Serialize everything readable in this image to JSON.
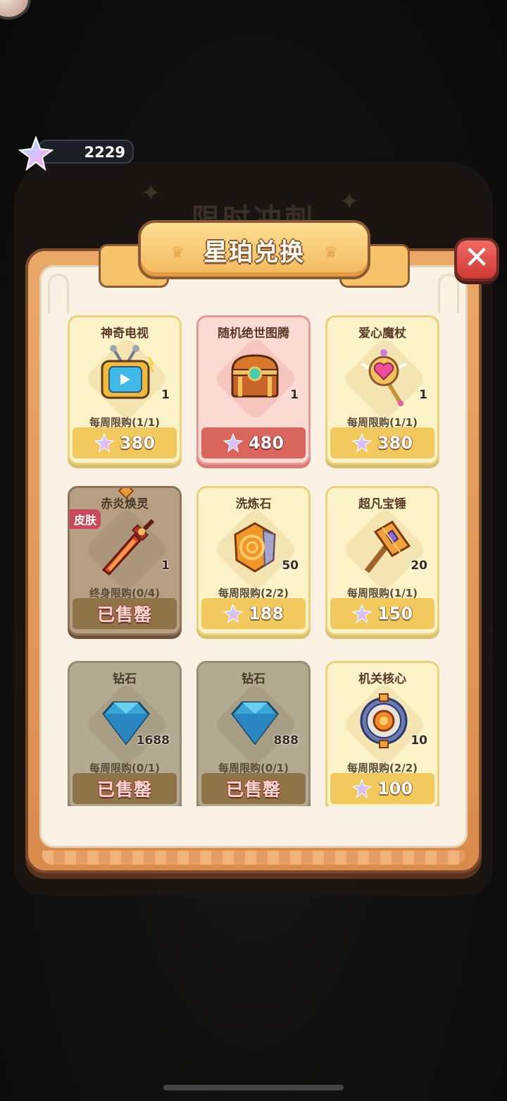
{
  "header": {
    "currency_value": "2229"
  },
  "dialog": {
    "background_title": "限时冲刺",
    "title": "星珀兑换",
    "close_label": "✕"
  },
  "items": [
    {
      "name": "神奇电视",
      "qty": "1",
      "limit": "每周限购(1/1)",
      "price": "380",
      "sold_out": "",
      "tag": "",
      "style": "yellow",
      "icon": "tv-icon"
    },
    {
      "name": "随机绝世图腾",
      "qty": "1",
      "limit": "",
      "price": "480",
      "sold_out": "",
      "tag": "",
      "style": "pink",
      "icon": "treasure-chest-icon"
    },
    {
      "name": "爱心魔杖",
      "qty": "1",
      "limit": "每周限购(1/1)",
      "price": "380",
      "sold_out": "",
      "tag": "",
      "style": "yellow",
      "icon": "heart-wand-icon"
    },
    {
      "name": "赤炎焕灵",
      "qty": "1",
      "limit": "终身限购(0/4)",
      "price": "",
      "sold_out": "已售罄",
      "tag": "皮肤",
      "style": "skin",
      "icon": "flame-sword-icon"
    },
    {
      "name": "洗炼石",
      "qty": "50",
      "limit": "每周限购(2/2)",
      "price": "188",
      "sold_out": "",
      "tag": "",
      "style": "yellow",
      "icon": "refine-stone-icon"
    },
    {
      "name": "超凡宝锤",
      "qty": "20",
      "limit": "每周限购(1/1)",
      "price": "150",
      "sold_out": "",
      "tag": "",
      "style": "yellow",
      "icon": "hammer-icon"
    },
    {
      "name": "钻石",
      "qty": "1688",
      "limit": "每周限购(0/1)",
      "price": "",
      "sold_out": "已售罄",
      "tag": "",
      "style": "grey",
      "icon": "diamond-icon"
    },
    {
      "name": "钻石",
      "qty": "888",
      "limit": "每周限购(0/1)",
      "price": "",
      "sold_out": "已售罄",
      "tag": "",
      "style": "grey",
      "icon": "diamond-icon"
    },
    {
      "name": "机关核心",
      "qty": "10",
      "limit": "每周限购(2/2)",
      "price": "100",
      "sold_out": "",
      "tag": "",
      "style": "yellow",
      "icon": "mech-core-icon"
    }
  ],
  "colors": {
    "background": "#0c0c0c",
    "panel": "#d98b4c",
    "card_yellow": "#fbf3c7",
    "card_pink": "#fbdad4",
    "price_bar": "#f2c95c",
    "close_button": "#cf3934"
  }
}
